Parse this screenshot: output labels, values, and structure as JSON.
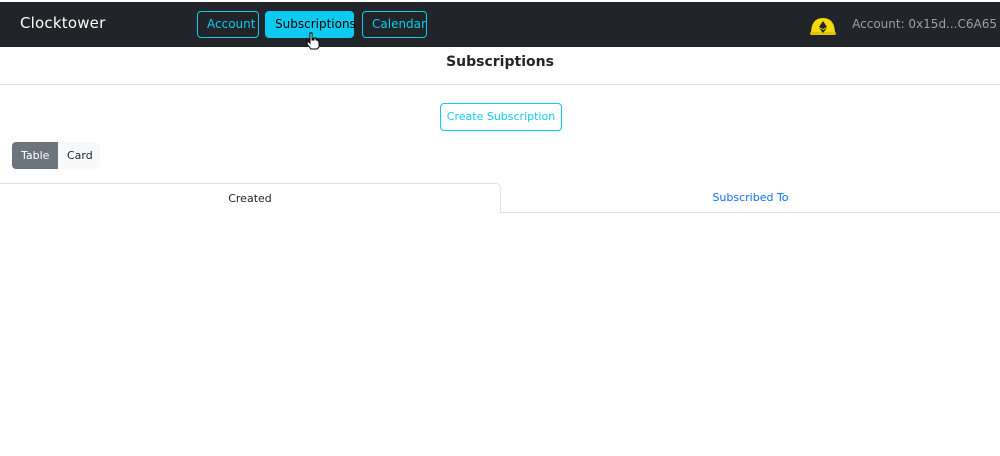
{
  "navbar": {
    "brand": "Clocktower",
    "buttons": [
      {
        "label": "Account",
        "active": false
      },
      {
        "label": "Subscriptions",
        "active": true
      },
      {
        "label": "Calendar",
        "active": false
      }
    ],
    "account_label": "Account: 0x15d...C6A65",
    "network_icon": "ethereum-badge-icon"
  },
  "page": {
    "title": "Subscriptions",
    "create_button": "Create Subscription",
    "view_toggle": {
      "options": [
        "Table",
        "Card"
      ],
      "selected": "Table"
    },
    "tabs": [
      {
        "label": "Created",
        "active": true
      },
      {
        "label": "Subscribed To",
        "active": false
      }
    ]
  },
  "colors": {
    "navbar_bg": "#212529",
    "accent": "#0dcaf0",
    "link": "#0d6efd",
    "toggle_active": "#6c757d"
  }
}
